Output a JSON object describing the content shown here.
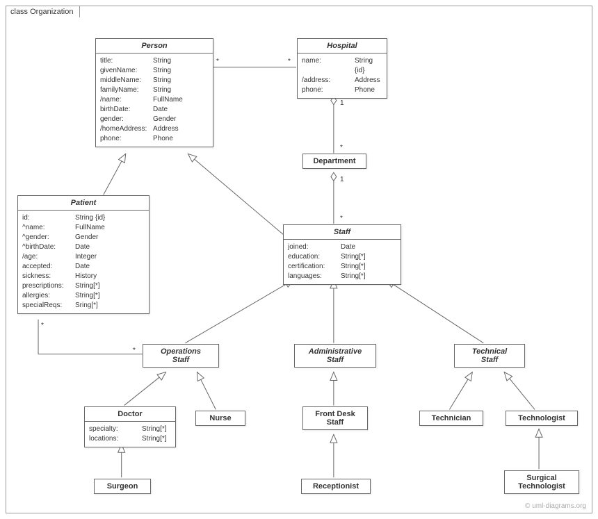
{
  "frame": {
    "label": "class Organization"
  },
  "watermark": "© uml-diagrams.org",
  "classes": {
    "person": {
      "name": "Person",
      "attrs": [
        {
          "name": "title:",
          "type": "String"
        },
        {
          "name": "givenName:",
          "type": "String"
        },
        {
          "name": "middleName:",
          "type": "String"
        },
        {
          "name": "familyName:",
          "type": "String"
        },
        {
          "name": "/name:",
          "type": "FullName"
        },
        {
          "name": "birthDate:",
          "type": "Date"
        },
        {
          "name": "gender:",
          "type": "Gender"
        },
        {
          "name": "/homeAddress:",
          "type": "Address"
        },
        {
          "name": "phone:",
          "type": "Phone"
        }
      ]
    },
    "hospital": {
      "name": "Hospital",
      "attrs": [
        {
          "name": "name:",
          "type": "String {id}"
        },
        {
          "name": "/address:",
          "type": "Address"
        },
        {
          "name": "phone:",
          "type": "Phone"
        }
      ]
    },
    "patient": {
      "name": "Patient",
      "attrs": [
        {
          "name": "id:",
          "type": "String {id}"
        },
        {
          "name": "^name:",
          "type": "FullName"
        },
        {
          "name": "^gender:",
          "type": "Gender"
        },
        {
          "name": "^birthDate:",
          "type": "Date"
        },
        {
          "name": "/age:",
          "type": "Integer"
        },
        {
          "name": "accepted:",
          "type": "Date"
        },
        {
          "name": "sickness:",
          "type": "History"
        },
        {
          "name": "prescriptions:",
          "type": "String[*]"
        },
        {
          "name": "allergies:",
          "type": "String[*]"
        },
        {
          "name": "specialReqs:",
          "type": "Sring[*]"
        }
      ]
    },
    "department": {
      "name": "Department"
    },
    "staff": {
      "name": "Staff",
      "attrs": [
        {
          "name": "joined:",
          "type": "Date"
        },
        {
          "name": "education:",
          "type": "String[*]"
        },
        {
          "name": "certification:",
          "type": "String[*]"
        },
        {
          "name": "languages:",
          "type": "String[*]"
        }
      ]
    },
    "opsStaff": {
      "name": "Operations Staff",
      "twoLine": [
        "Operations",
        "Staff"
      ]
    },
    "adminStaff": {
      "name": "Administrative Staff",
      "twoLine": [
        "Administrative",
        "Staff"
      ]
    },
    "techStaff": {
      "name": "Technical Staff",
      "twoLine": [
        "Technical",
        "Staff"
      ]
    },
    "doctor": {
      "name": "Doctor",
      "attrs": [
        {
          "name": "specialty:",
          "type": "String[*]"
        },
        {
          "name": "locations:",
          "type": "String[*]"
        }
      ]
    },
    "nurse": {
      "name": "Nurse"
    },
    "frontDesk": {
      "name": "Front Desk Staff",
      "twoLine": [
        "Front Desk",
        "Staff"
      ]
    },
    "technician": {
      "name": "Technician"
    },
    "technologist": {
      "name": "Technologist"
    },
    "surgeon": {
      "name": "Surgeon"
    },
    "receptionist": {
      "name": "Receptionist"
    },
    "surgTech": {
      "name": "Surgical Technologist",
      "twoLine": [
        "Surgical",
        "Technologist"
      ]
    }
  },
  "multiplicities": {
    "personHospL": "*",
    "personHospR": "*",
    "hospDeptT": "1",
    "hospDeptB": "*",
    "deptStaffT": "1",
    "deptStaffB": "*",
    "patientOpsL": "*",
    "patientOpsR": "*"
  }
}
